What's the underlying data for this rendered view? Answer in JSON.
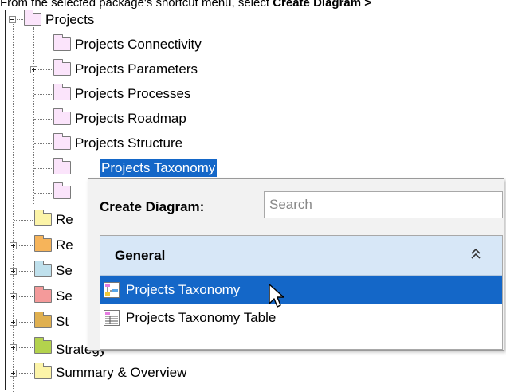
{
  "caption": {
    "prefix": "From the selected package's shortcut menu, select ",
    "bold": "Create Diagram >"
  },
  "tree": {
    "root": {
      "label": "Projects",
      "folder_color": "#fbe4fb"
    },
    "children": [
      {
        "label": "Projects Connectivity",
        "expandable": false
      },
      {
        "label": "Projects Parameters",
        "expandable": true
      },
      {
        "label": "Projects Processes",
        "expandable": false
      },
      {
        "label": "Projects Roadmap",
        "expandable": false
      },
      {
        "label": "Projects Structure",
        "expandable": false
      },
      {
        "label": "Projects Taxonomy",
        "expandable": false,
        "selected": true
      }
    ],
    "siblings": [
      {
        "label": "Re",
        "folder": "yellow"
      },
      {
        "label": "Re",
        "folder": "orange"
      },
      {
        "label": "Se",
        "folder": "blue"
      },
      {
        "label": "Se",
        "folder": "red"
      },
      {
        "label": "St",
        "folder": "gold"
      },
      {
        "label": "Strategy",
        "folder": "green"
      },
      {
        "label": "Summary & Overview",
        "folder": "yellow"
      }
    ]
  },
  "popup": {
    "title": "Create Diagram:",
    "search_placeholder": "Search",
    "group": "General",
    "items": [
      {
        "label": "Projects Taxonomy",
        "icon": "taxonomy-diagram-icon",
        "selected": true
      },
      {
        "label": "Projects Taxonomy Table",
        "icon": "taxonomy-table-icon",
        "selected": false
      }
    ]
  },
  "colors": {
    "selection": "#1467c8",
    "group_header": "#d7e7f7"
  }
}
